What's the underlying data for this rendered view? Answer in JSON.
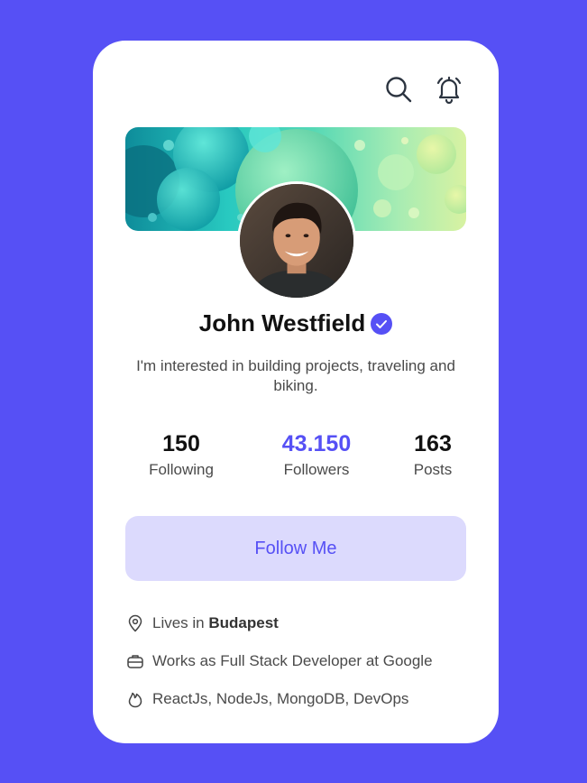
{
  "colors": {
    "background": "#5650f5",
    "accent": "#5650f5",
    "button_bg": "#dcdafd",
    "card": "#ffffff"
  },
  "header": {
    "icons": [
      "search-icon",
      "bell-icon"
    ]
  },
  "profile": {
    "name": "John Westfield",
    "verified": true,
    "bio": "I'm interested in building projects, traveling and biking."
  },
  "stats": [
    {
      "value": "150",
      "label": "Following"
    },
    {
      "value": "43.150",
      "label": "Followers"
    },
    {
      "value": "163",
      "label": "Posts"
    }
  ],
  "follow_button": {
    "label": "Follow Me"
  },
  "info": {
    "location_prefix": "Lives in ",
    "location_city": "Budapest",
    "work": "Works as Full Stack Developer at Google",
    "skills": "ReactJs, NodeJs, MongoDB, DevOps"
  }
}
